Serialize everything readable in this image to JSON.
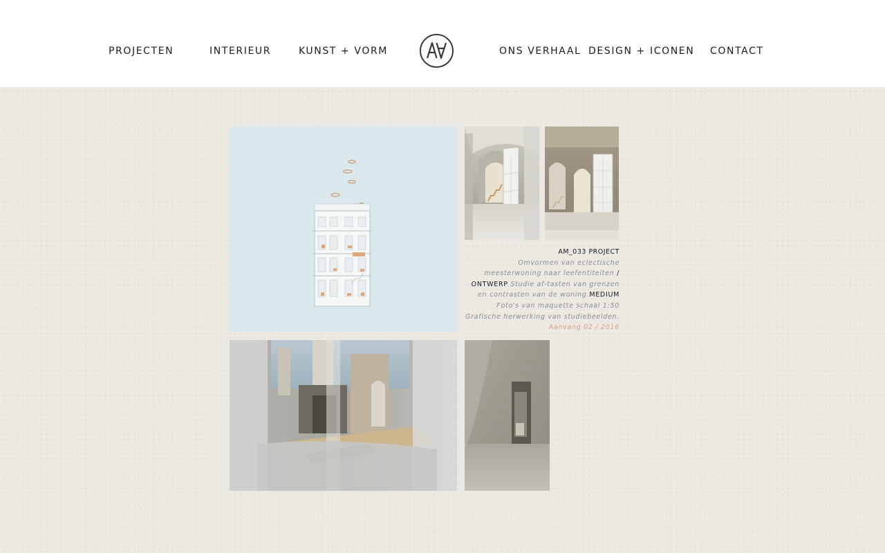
{
  "nav": {
    "left": [
      "PROJECTEN",
      "INTERIEUR",
      "KUNST + VORM"
    ],
    "right": [
      "ONS VERHAAL",
      "DESIGN + ICONEN",
      "CONTACT"
    ],
    "logo_text": "AA"
  },
  "project": {
    "title": "AM_033 PROJECT",
    "text_1": "Omvormen van eclectische meesterwoning naar leefentiteiten",
    "label_1": "/ ONTWERP",
    "text_2": "Studie af-tasten van grenzen en contrasten van de woning.",
    "label_2": "MEDIUM",
    "text_3": "Foto's van maquette schaal 1:50 Grafische herwerking van studiebeelden.",
    "date": "Aanvang 02 / 2016"
  },
  "colors": {
    "background": "#ebe8e1",
    "header": "#ffffff",
    "accent_date": "#d9a088",
    "text_dark": "#1b1b1b"
  }
}
